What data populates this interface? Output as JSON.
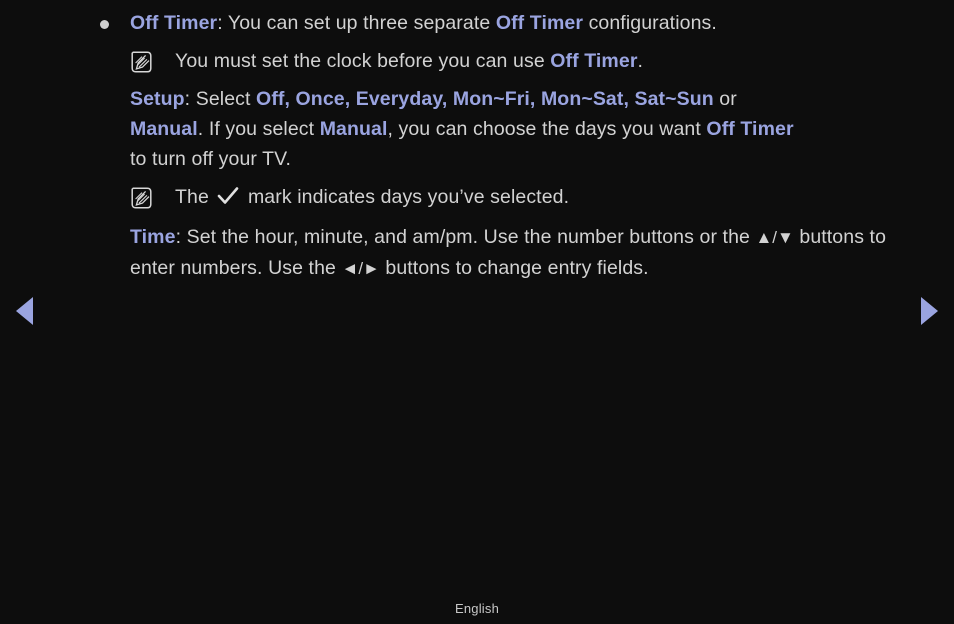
{
  "page": {
    "background_color": "#0d0d0d",
    "text_color": "#d2d2d2",
    "accent_color": "#9aa4e0",
    "footer_language": "English"
  },
  "bullet": {
    "icon": "bullet-dot",
    "title": "Off Timer",
    "colon": ": ",
    "text_before": "You can set up three separate ",
    "inline_term": "Off Timer",
    "text_after": " configurations."
  },
  "note_1": {
    "icon": "note-pencil-icon",
    "text_before": "You must set the clock before you can use ",
    "inline_term": "Off Timer",
    "text_after": "."
  },
  "setup": {
    "label": "Setup",
    "colon": ": ",
    "select_text": "Select ",
    "options": "Off, Once, Everyday, Mon~Fri, Mon~Sat, Sat~Sun",
    "or_text": " or",
    "line2_term_1": "Manual",
    "line2_mid_1": ". If you select ",
    "line2_term_2": "Manual",
    "line2_mid_2": ", you can choose the days you want ",
    "line2_term_3": "Off Timer",
    "line3": "to turn off your TV."
  },
  "note_2": {
    "icon": "note-pencil-icon",
    "text_before": "The ",
    "check_icon": "check-mark-icon",
    "text_after": " mark indicates days you’ve selected."
  },
  "time": {
    "label": "Time",
    "colon": ": ",
    "text_1": "Set the hour, minute, and am/pm. Use the number buttons or the ",
    "updown_symbol": "▲/▼",
    "text_2": " buttons to enter numbers. Use the ",
    "leftright_symbol": "◄/►",
    "text_3": " buttons to change entry fields."
  },
  "navigation": {
    "prev_label": "prev-page-arrow",
    "next_label": "next-page-arrow"
  }
}
